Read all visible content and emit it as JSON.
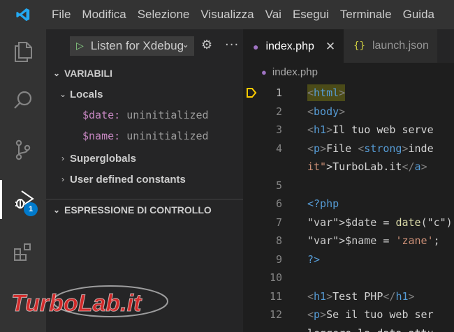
{
  "menu": [
    "File",
    "Modifica",
    "Selezione",
    "Visualizza",
    "Vai",
    "Esegui",
    "Terminale",
    "Guida"
  ],
  "activity_bar": {
    "items": [
      "explorer-icon",
      "search-icon",
      "source-control-icon",
      "run-debug-icon",
      "extensions-icon"
    ],
    "debug_badge": "1"
  },
  "debug_toolbar": {
    "configuration": "Listen for Xdebug",
    "settings_icon": "gear-icon",
    "more_icon": "ellipsis-icon"
  },
  "variables": {
    "section_title": "VARIABILI",
    "locals_label": "Locals",
    "locals": [
      {
        "name": "$date:",
        "value": "uninitialized"
      },
      {
        "name": "$name:",
        "value": "uninitialized"
      }
    ],
    "superglobals_label": "Superglobals",
    "user_constants_label": "User defined constants"
  },
  "watch": {
    "section_title": "ESPRESSIONE DI CONTROLLO"
  },
  "tabs": [
    {
      "label": "index.php",
      "active": true
    },
    {
      "label": "launch.json",
      "active": false
    }
  ],
  "breadcrumb": "index.php",
  "code_lines": [
    {
      "n": "1",
      "text": "<html>"
    },
    {
      "n": "2",
      "text": "<body>"
    },
    {
      "n": "3",
      "text": "<h1>Il tuo web serve"
    },
    {
      "n": "4",
      "text": "<p>File <strong>inde"
    },
    {
      "n": "",
      "text": "it\">TurboLab.it</a><"
    },
    {
      "n": "5",
      "text": ""
    },
    {
      "n": "6",
      "text": "<?php"
    },
    {
      "n": "7",
      "text": "$date = date(\"c\");"
    },
    {
      "n": "8",
      "text": "$name = 'zane';"
    },
    {
      "n": "9",
      "text": "?>"
    },
    {
      "n": "10",
      "text": ""
    },
    {
      "n": "11",
      "text": "<h1>Test PHP</h1>"
    },
    {
      "n": "12",
      "text": "<p>Se il tuo web ser"
    },
    {
      "n": "",
      "text": "leggere la data attu"
    }
  ],
  "watermark": "TurboLab.it",
  "colors": {
    "accent": "#007acc",
    "breakpoint_arrow": "#ffcc00",
    "current_line": "#4b4b18"
  }
}
